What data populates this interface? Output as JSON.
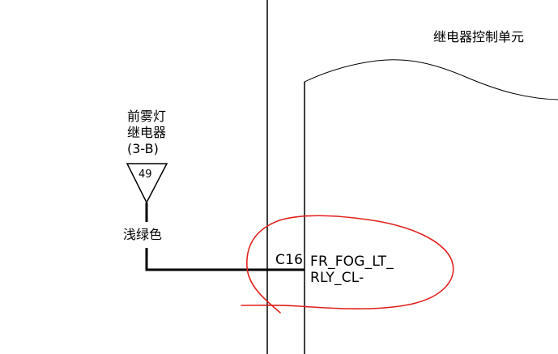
{
  "module": {
    "title": "继电器控制单元"
  },
  "relay": {
    "line1": "前雾灯",
    "line2": "继电器",
    "line3": "(3-B)",
    "pin": "49"
  },
  "wire": {
    "color_label": "浅绿色"
  },
  "connector": {
    "pin": "C16",
    "signal_line1": "FR_FOG_LT_",
    "signal_line2": "RLY_CL-"
  },
  "colors": {
    "line": "#000000",
    "annotation": "#e0201c",
    "background": "#ffffff"
  },
  "icons": {
    "relay_terminal": "downward-triangle",
    "annotation": "red-hand-drawn-circle"
  }
}
